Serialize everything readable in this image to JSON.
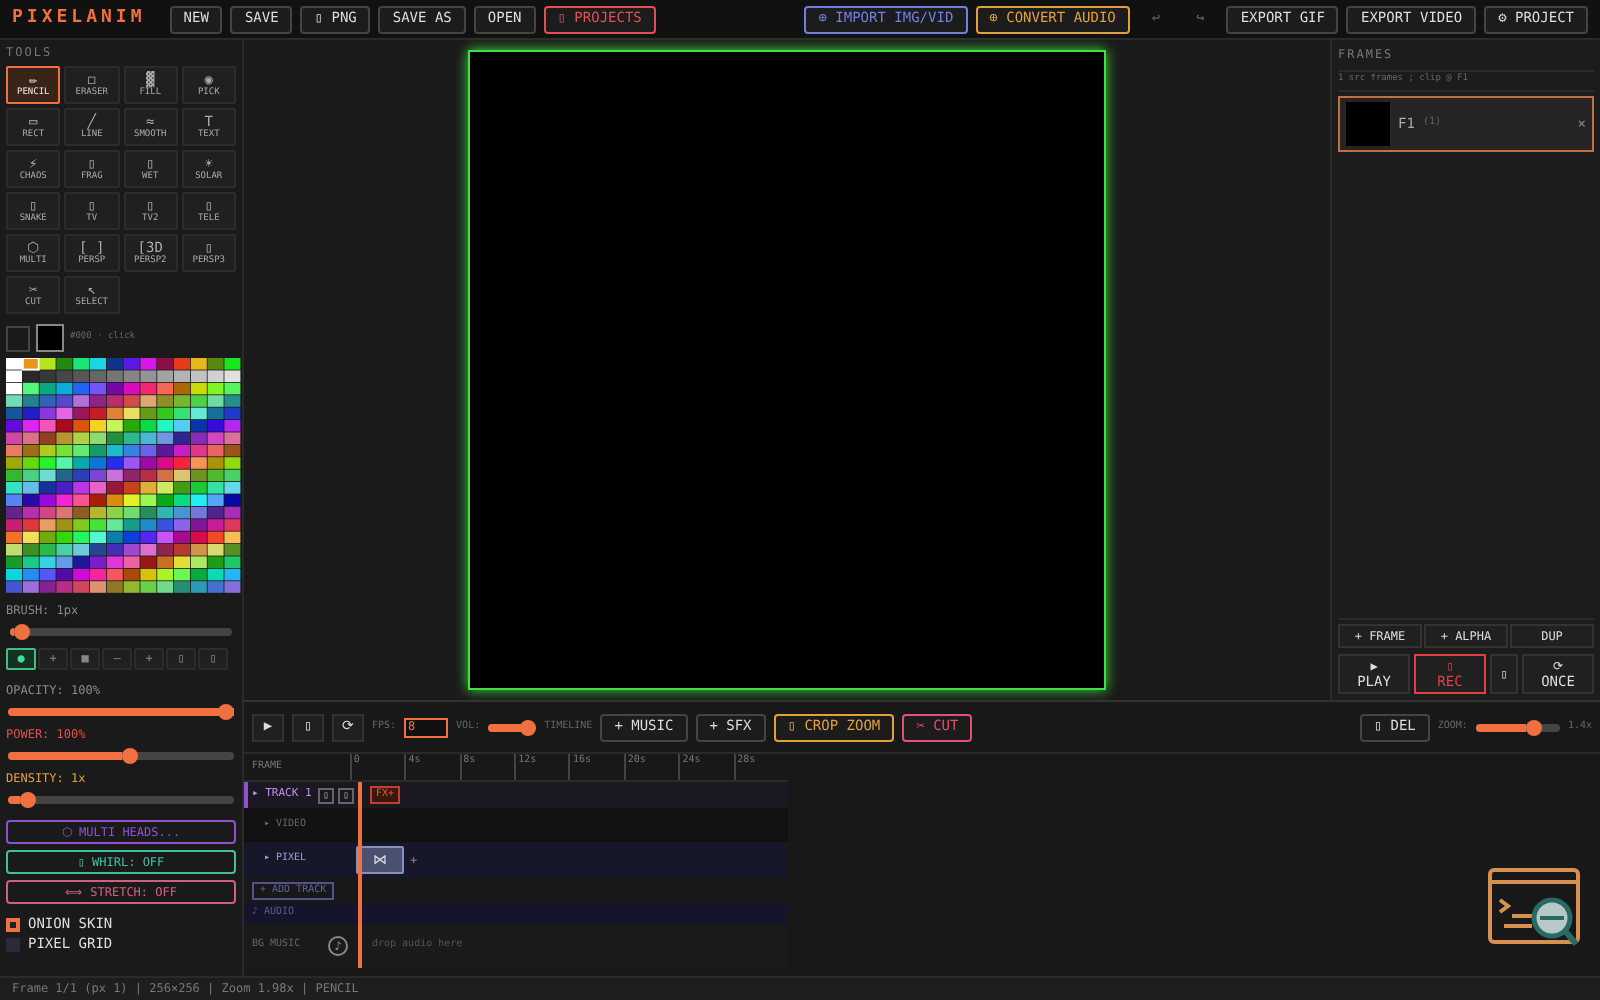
{
  "app": {
    "logo": "PIXELANIM"
  },
  "toolbar": {
    "left": [
      {
        "label": "NEW"
      },
      {
        "label": "SAVE"
      },
      {
        "label": "▯ PNG"
      },
      {
        "label": "SAVE AS"
      },
      {
        "label": "OPEN"
      },
      {
        "label": "▯ PROJECTS",
        "color": "#e05050"
      }
    ],
    "right": [
      {
        "label": "⊕ IMPORT IMG/VID",
        "color": "#7080e0",
        "disabled": false
      },
      {
        "label": "⊕ CONVERT AUDIO",
        "color": "#e0a040",
        "disabled": false
      },
      {
        "label": "↩",
        "disabled": true
      },
      {
        "label": "↪",
        "disabled": true
      },
      {
        "label": "EXPORT GIF",
        "disabled": false
      },
      {
        "label": "EXPORT VIDEO",
        "disabled": false
      },
      {
        "label": "⚙ PROJECT",
        "disabled": false
      }
    ]
  },
  "tools": {
    "title": "TOOLS",
    "items": [
      {
        "icon": "✏",
        "label": "PENCIL",
        "selected": true
      },
      {
        "icon": "◻",
        "label": "ERASER",
        "selected": false
      },
      {
        "icon": "▓",
        "label": "FILL",
        "selected": false
      },
      {
        "icon": "◉",
        "label": "PICK",
        "selected": false
      },
      {
        "icon": "▭",
        "label": "RECT",
        "selected": false
      },
      {
        "icon": "╱",
        "label": "LINE",
        "selected": false
      },
      {
        "icon": "≈",
        "label": "SMOOTH",
        "selected": false
      },
      {
        "icon": "T",
        "label": "TEXT",
        "selected": false
      },
      {
        "icon": "⚡",
        "label": "CHAOS",
        "selected": false
      },
      {
        "icon": "▯",
        "label": "FRAG",
        "selected": false
      },
      {
        "icon": "▯",
        "label": "WET",
        "selected": false
      },
      {
        "icon": "☀",
        "label": "SOLAR",
        "selected": false
      },
      {
        "icon": "▯",
        "label": "SNAKE",
        "selected": false
      },
      {
        "icon": "▯",
        "label": "TV",
        "selected": false
      },
      {
        "icon": "▯",
        "label": "TV2",
        "selected": false
      },
      {
        "icon": "▯",
        "label": "TELE",
        "selected": false
      },
      {
        "icon": "⬡",
        "label": "MULTI",
        "selected": false
      },
      {
        "icon": "[ ]",
        "label": "PERSP",
        "selected": false
      },
      {
        "icon": "[3D",
        "label": "PERSP2",
        "selected": false
      },
      {
        "icon": "▯",
        "label": "PERSP3",
        "selected": false
      },
      {
        "icon": "✂",
        "label": "CUT",
        "selected": false
      },
      {
        "icon": "↖",
        "label": "SELECT",
        "selected": false
      }
    ]
  },
  "colors": {
    "hint": "#000 · click"
  },
  "brush": {
    "label": "BRUSH: 1px",
    "level": 0.02,
    "shapes": [
      {
        "icon": "●",
        "selected": true
      },
      {
        "icon": "+",
        "selected": false
      },
      {
        "icon": "■",
        "selected": false
      },
      {
        "icon": "—",
        "selected": false
      },
      {
        "icon": "+",
        "selected": false
      },
      {
        "icon": "▯",
        "selected": false
      },
      {
        "icon": "▯",
        "selected": false
      }
    ]
  },
  "effects": {
    "sliders": [
      {
        "label": "OPACITY: 100%",
        "level": 1,
        "color": "#8a8a8a"
      },
      {
        "label": "POWER: 100%",
        "level": 0.5,
        "color": "#e05050"
      },
      {
        "label": "DENSITY: 1x",
        "level": 0.05,
        "color": "#e0a040"
      }
    ],
    "buttons": [
      {
        "label": "⬡ MULTI HEADS...",
        "color": "#9050d0"
      },
      {
        "label": "▯ WHIRL: OFF",
        "color": "#40c0a0"
      },
      {
        "label": "⟺ STRETCH: OFF",
        "color": "#d06080"
      }
    ],
    "options": [
      {
        "label": "ONION SKIN",
        "checked": true
      },
      {
        "label": "PIXEL GRID",
        "checked": false
      }
    ]
  },
  "frames": {
    "title": "FRAMES",
    "info": "1 src frames ; clip @ F1",
    "items": [
      {
        "name": "F1",
        "count": "(1)",
        "close": "×",
        "selected": true
      }
    ],
    "actions": [
      "+ FRAME",
      "+ ALPHA",
      "DUP"
    ],
    "transport": [
      {
        "icon": "▶",
        "label": "PLAY"
      },
      {
        "icon": "▯",
        "label": "REC",
        "color": "#e04040"
      },
      {
        "icon": "▯"
      },
      {
        "icon": "⟳",
        "label": "ONCE"
      }
    ]
  },
  "timeline": {
    "controls": [
      "▶",
      "▯",
      "⟳"
    ],
    "fps": {
      "label": "FPS:",
      "value": "8"
    },
    "vol": {
      "label": "VOL:",
      "level": 0.85
    },
    "label": "TIMELINE",
    "actions": [
      {
        "label": "+ MUSIC"
      },
      {
        "label": "+ SFX"
      },
      {
        "label": "▯ CROP ZOOM",
        "color": "#e0a040"
      },
      {
        "label": "✂ CUT",
        "color": "#e05070"
      }
    ],
    "del": "▯ DEL",
    "zoom": {
      "label": "ZOOM:",
      "level": 0.6,
      "reading": "1.4x"
    },
    "ruler": {
      "label": "FRAME",
      "ticks": [
        "0",
        "4s",
        "8s",
        "12s",
        "16s",
        "20s",
        "24s",
        "28s"
      ]
    },
    "tracks": [
      {
        "kind": "track",
        "label": "▸ TRACK 1",
        "buttons": [
          "▯",
          "▯"
        ],
        "fx": "FX+"
      },
      {
        "kind": "lane",
        "label": "▸ VIDEO"
      },
      {
        "kind": "lane",
        "label": "▸ PIXEL",
        "clip": "⋈",
        "add": "+"
      },
      {
        "kind": "add",
        "label": "+ ADD TRACK"
      },
      {
        "kind": "audio",
        "label": "♪ AUDIO"
      },
      {
        "kind": "music",
        "label": "BG MUSIC",
        "icon": "♪",
        "hint": "drop audio here"
      }
    ]
  },
  "status": "Frame 1/1 (px 1) | 256×256 | Zoom 1.98x | PENCIL"
}
